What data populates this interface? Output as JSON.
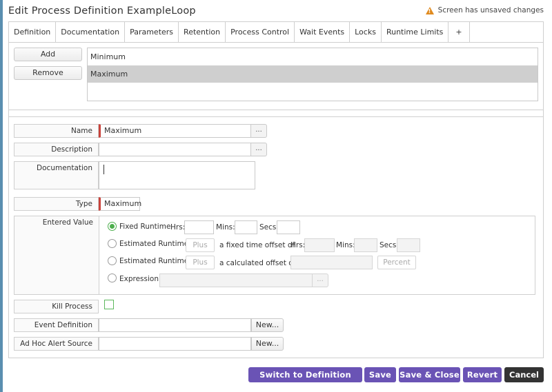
{
  "window": {
    "title": "Edit Process Definition ExampleLoop",
    "unsaved_warning": "Screen has unsaved changes"
  },
  "tabs": [
    {
      "label": "Definition"
    },
    {
      "label": "Documentation"
    },
    {
      "label": "Parameters"
    },
    {
      "label": "Retention"
    },
    {
      "label": "Process Control"
    },
    {
      "label": "Wait Events"
    },
    {
      "label": "Locks"
    },
    {
      "label": "Runtime Limits",
      "active": true
    },
    {
      "label": "+"
    }
  ],
  "list_actions": {
    "add": "Add",
    "remove": "Remove"
  },
  "limits_list": [
    {
      "label": "Minimum",
      "selected": false
    },
    {
      "label": "Maximum",
      "selected": true
    }
  ],
  "form": {
    "name": {
      "label": "Name",
      "value": "Maximum",
      "ellipsis": "..."
    },
    "description": {
      "label": "Description",
      "value": "",
      "ellipsis": "..."
    },
    "documentation": {
      "label": "Documentation",
      "value": ""
    },
    "type": {
      "label": "Type",
      "value": "Maximum"
    },
    "entered_value": {
      "label": "Entered Value",
      "fixed_runtime": {
        "label": "Fixed Runtime",
        "selected": true,
        "hrs": "Hrs:",
        "mins": "Mins:",
        "secs": "Secs:"
      },
      "estimated_fixed": {
        "label": "Estimated Runtime",
        "plus": "Plus",
        "offset_text": "a fixed time offset of",
        "hrs": "Hrs:",
        "mins": "Mins:",
        "secs": "Secs:"
      },
      "estimated_calc": {
        "label": "Estimated Runtime",
        "plus": "Plus",
        "offset_text": "a calculated offset of",
        "percent": "Percent"
      },
      "expression": {
        "label": "Expression",
        "ellipsis": "..."
      }
    },
    "kill_process": {
      "label": "Kill Process",
      "checked": false
    },
    "event_definition": {
      "label": "Event Definition",
      "button": "New..."
    },
    "ad_hoc_alert": {
      "label": "Ad Hoc Alert Source",
      "button": "New..."
    }
  },
  "footer": {
    "switch": "Switch to Definition Studio",
    "save": "Save",
    "save_close": "Save & Close",
    "revert": "Revert",
    "cancel": "Cancel"
  },
  "colors": {
    "primary": "#6a53b5",
    "required": "#c9423b",
    "radio_on": "#4cae4c",
    "warning": "#e08a1e"
  }
}
